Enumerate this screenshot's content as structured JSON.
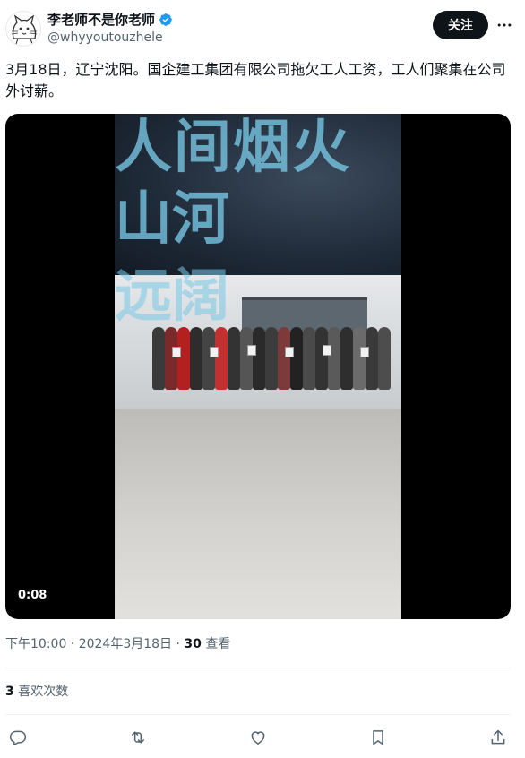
{
  "author": {
    "display_name": "李老师不是你老师",
    "handle": "@whyyoutouzhele",
    "verified_icon": "verified-badge-icon",
    "avatar_icon": "cat-sketch-avatar"
  },
  "header": {
    "follow_label": "关注",
    "more_icon": "more-horizontal-icon"
  },
  "tweet": {
    "text": "3月18日，辽宁沈阳。国企建工集团有限公司拖欠工人工资，工人们聚集在公司外讨薪。"
  },
  "media": {
    "overlay_line1": "人间烟火",
    "overlay_line2": "山河",
    "overlay_line3": "远阔",
    "duration": "0:08"
  },
  "meta": {
    "timestamp": "下午10:00 · 2024年3月18日 · ",
    "views_count": "30",
    "views_label": " 查看"
  },
  "engagement": {
    "likes_count": "3",
    "likes_label": " 喜欢次数"
  },
  "actions": {
    "reply_icon": "reply-icon",
    "retweet_icon": "retweet-icon",
    "like_icon": "heart-icon",
    "bookmark_icon": "bookmark-icon",
    "share_icon": "share-icon"
  },
  "colors": {
    "text_primary": "#0f1419",
    "text_secondary": "#536471",
    "verified_blue": "#1d9bf0",
    "divider": "#eff3f4"
  }
}
